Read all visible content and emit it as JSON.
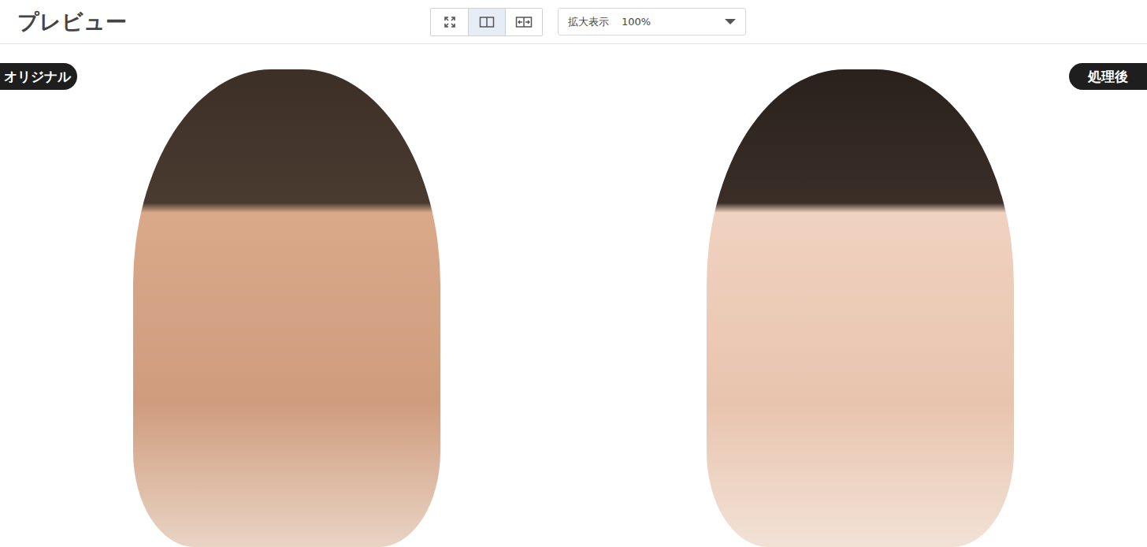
{
  "header": {
    "title": "プレビュー"
  },
  "view_modes": [
    {
      "kind": "fit",
      "selected": false
    },
    {
      "kind": "split",
      "selected": true
    },
    {
      "kind": "slider",
      "selected": false
    }
  ],
  "zoom": {
    "label": "拡大表示",
    "value": "100%"
  },
  "panels": [
    {
      "kind": "original",
      "badge": "オリジナル"
    },
    {
      "kind": "processed",
      "badge": "処理後"
    }
  ]
}
